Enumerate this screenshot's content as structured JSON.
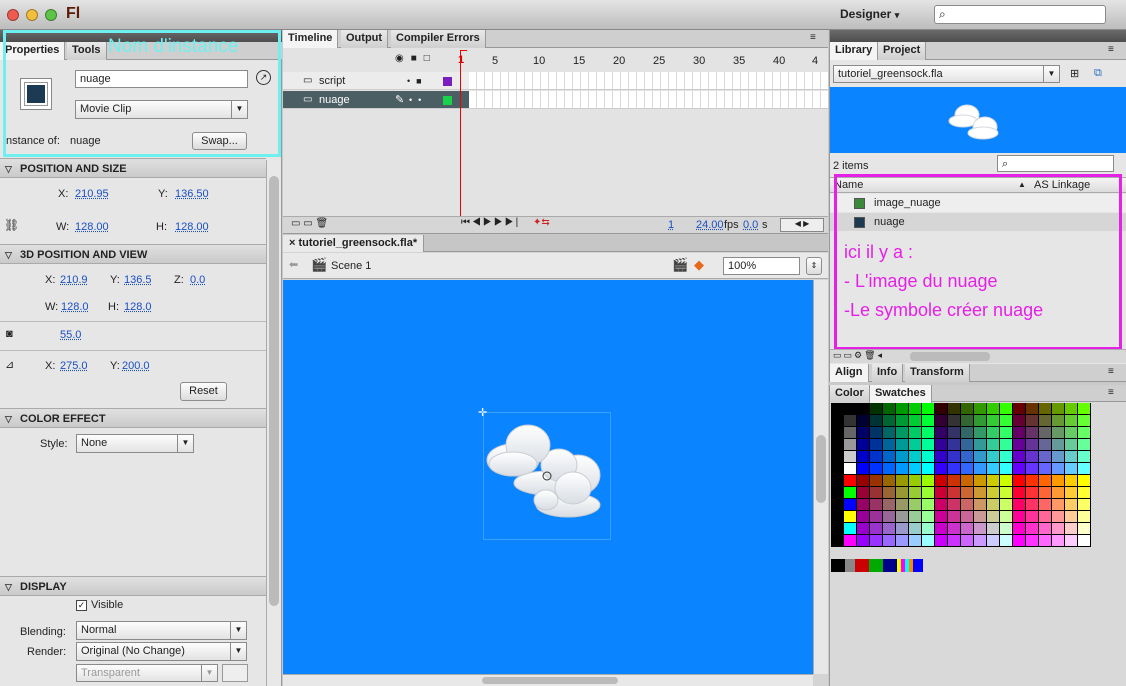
{
  "app": {
    "logo": "Fl",
    "workspace": "Designer",
    "search_placeholder": ""
  },
  "properties": {
    "tabs": [
      "Properties",
      "Tools"
    ],
    "annotation": "Nom d'instance",
    "instance_name": "nuage",
    "symbol_type": "Movie Clip",
    "instance_of_label": "Instance of:",
    "instance_of_value": "nuage",
    "swap_label": "Swap...",
    "pos_section": "POSITION AND SIZE",
    "x_label": "X:",
    "x_value": "210.95",
    "y_label": "Y:",
    "y_value": "136.50",
    "w_label": "W:",
    "w_value": "128.00",
    "h_label": "H:",
    "h_value": "128.00",
    "pos3d_section": "3D POSITION AND VIEW",
    "x3_label": "X:",
    "x3_value": "210.9",
    "y3_label": "Y:",
    "y3_value": "136.5",
    "z3_label": "Z:",
    "z3_value": "0.0",
    "w3_label": "W:",
    "w3_value": "128.0",
    "h3_label": "H:",
    "h3_value": "128.0",
    "perspective_value": "55.0",
    "vx_label": "X:",
    "vx_value": "275.0",
    "vy_label": "Y:",
    "vy_value": "200.0",
    "reset_label": "Reset",
    "color_section": "COLOR EFFECT",
    "style_label": "Style:",
    "style_value": "None",
    "display_section": "DISPLAY",
    "visible_label": "Visible",
    "blending_label": "Blending:",
    "blending_value": "Normal",
    "render_label": "Render:",
    "render_value": "Original (No Change)",
    "transparent_value": "Transparent"
  },
  "timeline": {
    "tabs": [
      "Timeline",
      "Output",
      "Compiler Errors"
    ],
    "ruler": [
      "1",
      "5",
      "10",
      "15",
      "20",
      "25",
      "30",
      "35",
      "40",
      "4"
    ],
    "layers": [
      {
        "name": "script"
      },
      {
        "name": "nuage"
      }
    ],
    "current_frame": "1",
    "fps": "24.00",
    "fps_unit": "fps",
    "time": "0.0",
    "time_unit": "s"
  },
  "document": {
    "tab": "tutoriel_greensock.fla*",
    "scene": "Scene 1",
    "zoom": "100%",
    "stage_color": "#0a84ff"
  },
  "library": {
    "tabs": [
      "Library",
      "Project"
    ],
    "file": "tutoriel_greensock.fla",
    "count": "2 items",
    "col_name": "Name",
    "col_linkage": "AS Linkage",
    "items": [
      {
        "name": "image_nuage"
      },
      {
        "name": "nuage"
      }
    ],
    "annotation_lines": [
      "ici il y a :",
      "- L'image du nuage",
      "-Le symbole créer nuage"
    ]
  },
  "align_panel": {
    "tabs": [
      "Align",
      "Info",
      "Transform"
    ]
  },
  "swatches_panel": {
    "tabs": [
      "Color",
      "Swatches"
    ]
  },
  "colors": {
    "accent_cyan": "#6ef0f0",
    "accent_magenta": "#e620e6",
    "selection": "#4a5e63"
  }
}
